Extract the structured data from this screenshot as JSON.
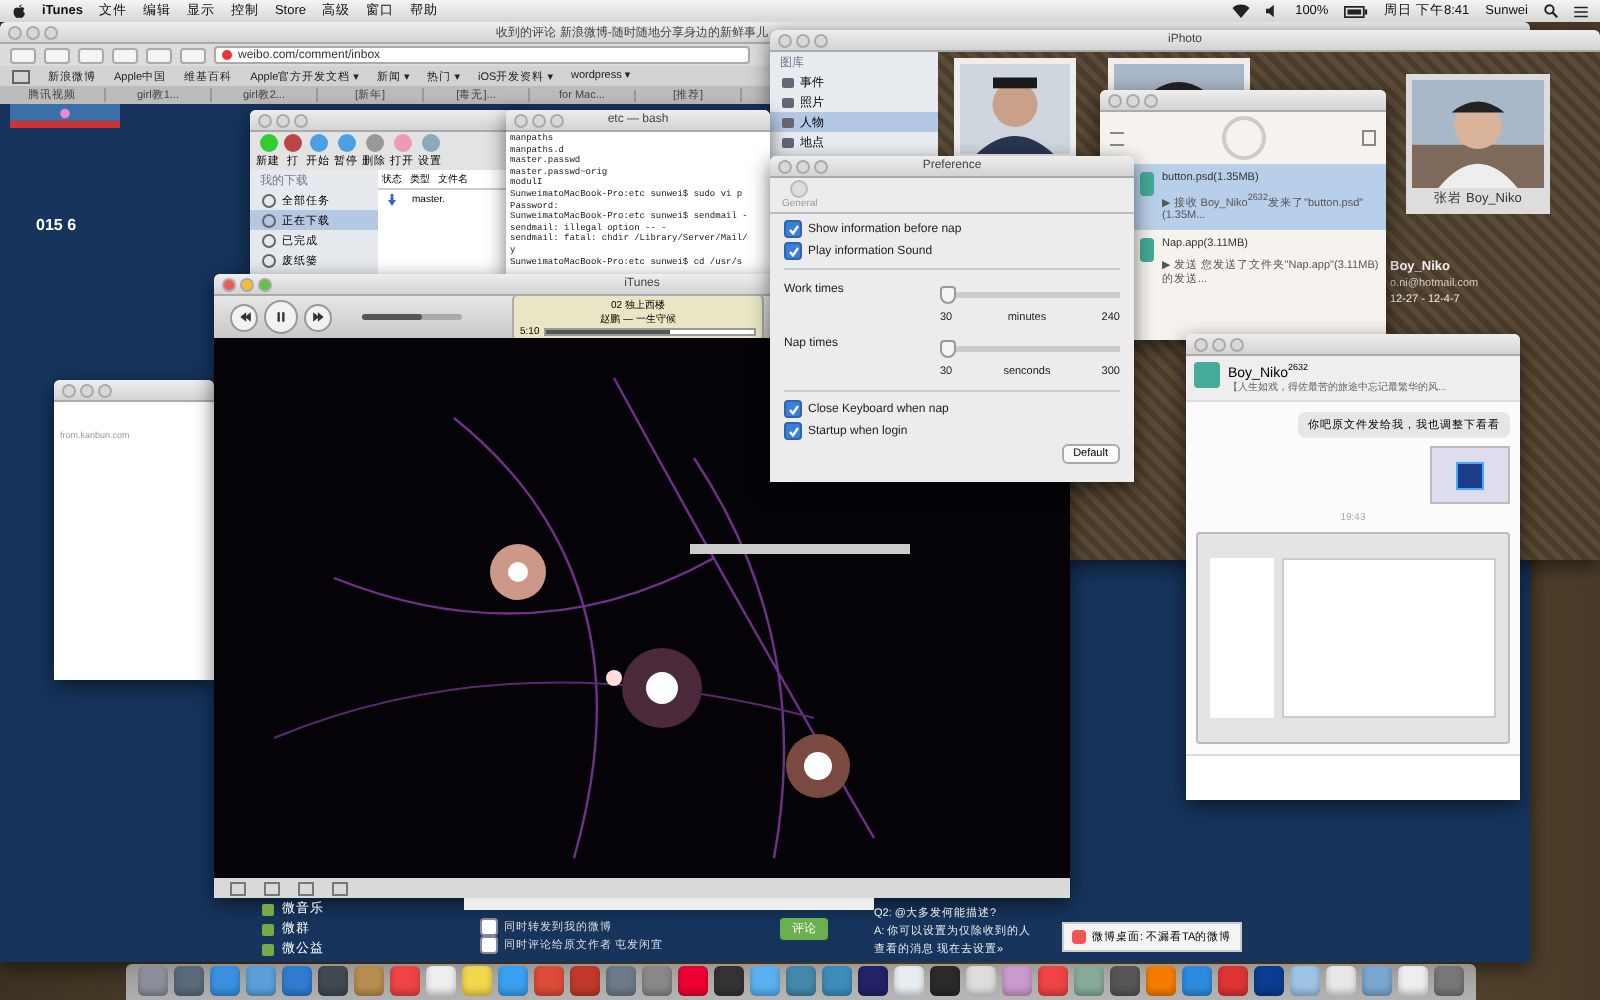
{
  "menubar": {
    "app": "iTunes",
    "menus": [
      "文件",
      "编辑",
      "显示",
      "控制",
      "Store",
      "高级",
      "窗口",
      "帮助"
    ],
    "battery": "100%",
    "clock": "周日 下午8:41",
    "user": "Sunwei"
  },
  "browser": {
    "title": "收到的评论 新浪微博-随时随地分享身边的新鲜事儿",
    "url": "weibo.com/comment/inbox",
    "bookmarks": [
      "新浪微博",
      "Apple中国",
      "维基百科",
      "Apple官方开发文档 ▾",
      "新闻 ▾",
      "热门 ▾",
      "iOS开发资料 ▾",
      "wordpress ▾"
    ],
    "tabs": [
      "腾讯视频",
      "girl教1...",
      "girl教2...",
      "[新年]",
      "[毒无]...",
      "for Mac...",
      "[推荐]"
    ],
    "profile_text": "015 6",
    "login_site": "from.kanbun.com",
    "side_items": [
      "微音乐",
      "微群",
      "微公益"
    ],
    "options": [
      {
        "label": "同时转发到我的微博",
        "checked": false
      },
      {
        "label": "同时评论给原文作者 屯发闲宜",
        "checked": false
      }
    ],
    "submit": "评论",
    "qa": [
      "Q2: @大多发何能描述?",
      "A: 你可以设置为仅除收到的人",
      "查看的消息 现在去设置»"
    ]
  },
  "iphoto": {
    "title": "iPhoto",
    "section": "图库",
    "items": [
      {
        "label": "事件",
        "selected": false
      },
      {
        "label": "照片",
        "selected": false
      },
      {
        "label": "人物",
        "selected": true
      },
      {
        "label": "地点",
        "selected": false
      }
    ],
    "caption": "张岩 Boy_Niko",
    "name": "Boy_Niko",
    "email": "o.ni@hotmail.com",
    "dates": "12-27 - 12-4-7"
  },
  "transfers": [
    {
      "file": "button.psd(1.35MB)",
      "detail": "▶ 接收  Boy_Niko$^{2632}$发来了\"button.psd\"(1.35M...",
      "selected": true
    },
    {
      "file": "Nap.app(3.11MB)",
      "detail": "▶ 发送  您发送了文件夹\"Nap.app\"(3.11MB)的发送...",
      "selected": false
    }
  ],
  "downloader": {
    "toolbar": [
      "新建",
      "打",
      "开始",
      "暂停",
      "删除",
      "打开",
      "设置"
    ],
    "section": "我的下载",
    "items": [
      {
        "label": "全部任务",
        "selected": false
      },
      {
        "label": "正在下载",
        "selected": true
      },
      {
        "label": "已完成",
        "selected": false
      },
      {
        "label": "废纸篓",
        "selected": false
      }
    ],
    "columns": [
      "状态",
      "类型",
      "文件名"
    ],
    "row": "master."
  },
  "terminal": {
    "title": "etc — bash",
    "lines": [
      "manpaths",
      "manpaths.d",
      "master.passwd",
      "master.passwd~orig",
      "modulI",
      "SunweimatoMacBook-Pro:etc sunwei$ sudo vi p",
      "Password:",
      "SunweimatoMacBook-Pro:etc sunwei$ sendmail -",
      "sendmail: illegal option -- -",
      "sendmail: fatal: chdir /Library/Server/Mail/",
      "y",
      "SunweimatoMacBook-Pro:etc sunwei$ cd /usr/s"
    ]
  },
  "itunes": {
    "title": "iTunes",
    "track": "02 独上西楼",
    "artist": "赵鹏 — 一生守候",
    "elapsed": "5:10",
    "volume": {
      "level": 0.6
    },
    "progress": {
      "level": 0.6
    }
  },
  "preference": {
    "title": "Preference",
    "tab": "General",
    "checks_top": [
      {
        "label": "Show information before nap",
        "checked": true
      },
      {
        "label": "Play information Sound",
        "checked": true
      }
    ],
    "sliders": [
      {
        "label": "Work times",
        "level": 0,
        "min": "30",
        "unit": "minutes",
        "max": "240"
      },
      {
        "label": "Nap times",
        "level": 0,
        "min": "30",
        "unit": "senconds",
        "max": "300"
      }
    ],
    "checks_bottom": [
      {
        "label": "Close Keyboard when nap",
        "checked": true
      },
      {
        "label": "Startup when login",
        "checked": true
      }
    ],
    "button": "Default"
  },
  "chat": {
    "name": "Boy_Niko",
    "badge": "2632",
    "status": "【人生如戏，得佐最苦的旅途中忘记最繁华的风...",
    "message": "你吧原文件发给我，我也调整下看看",
    "time": "19:43"
  },
  "notification": {
    "text": "微博桌面: 不漏看TA的微博"
  }
}
